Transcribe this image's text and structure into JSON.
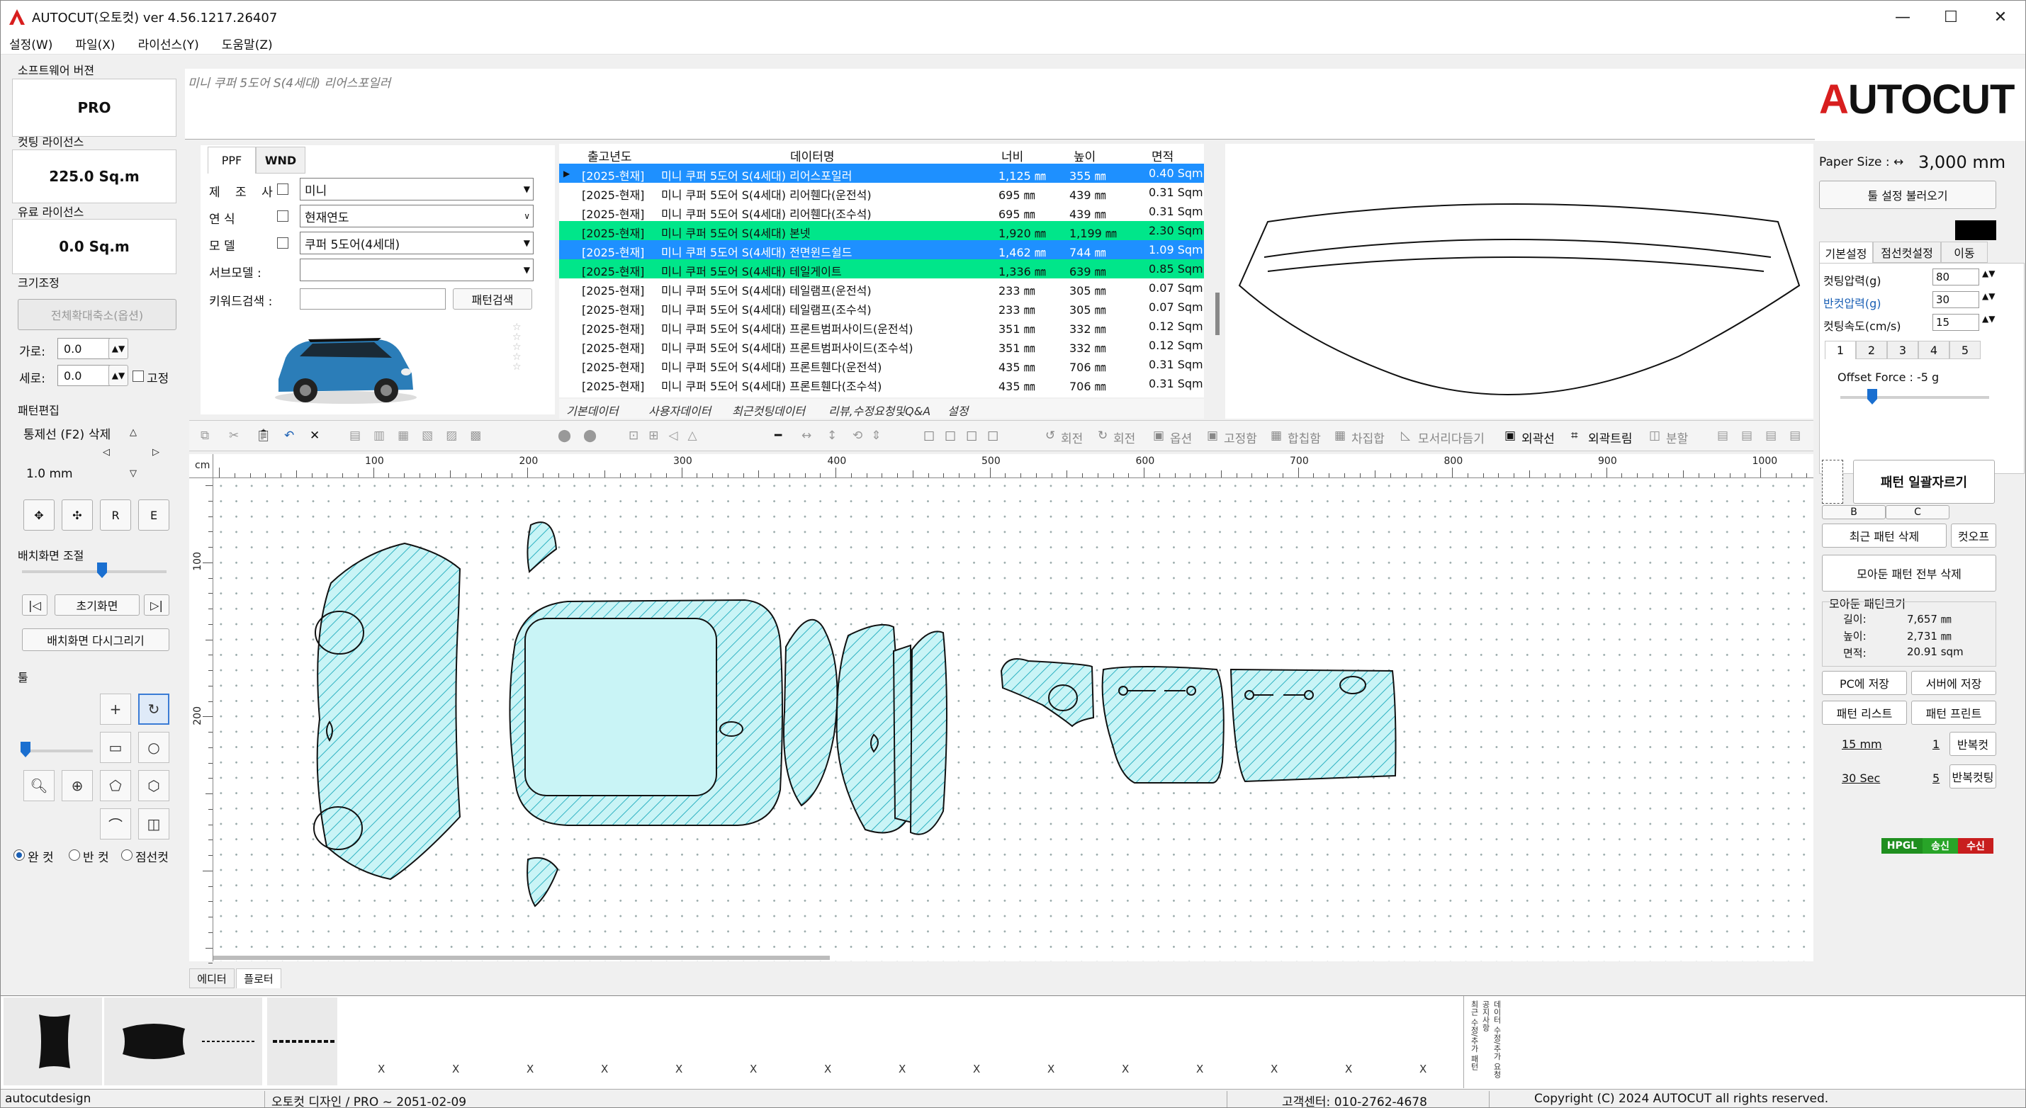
{
  "window": {
    "title": "AUTOCUT(오토컷) ver 4.56.1217.26407",
    "minimize": "—",
    "maximize": "☐",
    "close": "✕"
  },
  "menu": [
    "설정(W)",
    "파일(X)",
    "라이선스(Y)",
    "도움말(Z)"
  ],
  "left": {
    "software_version_label": "소프트웨어 버젼",
    "software_version": "PRO",
    "cutting_license_label": "컷팅 라이선스",
    "cutting_license": "225.0 Sq.m",
    "paid_license_label": "유료 라이선스",
    "paid_license": "0.0 Sq.m",
    "resize_label": "크기조정",
    "resize_all_btn": "전체확대축소(옵션)",
    "width_label": "가로:",
    "width_value": "0.0",
    "height_label": "세로:",
    "height_value": "0.0",
    "fix_label": "고정",
    "pattern_edit_label": "패턴편집",
    "move_label": "통제선 (F2)",
    "delete_label": "삭제",
    "step_value": "1.0 mm",
    "r_btn": "R",
    "e_btn": "E",
    "layout_label": "배치화면 조절",
    "reset_view_btn": "초기화면",
    "redraw_btn": "배치화면 다시그리기",
    "tools_label": "툴",
    "cut_modes": [
      "완 컷",
      "반 컷",
      "점선컷"
    ]
  },
  "header": {
    "breadcrumb": "미니 쿠퍼 5도어 S(4세대) 리어스포일러"
  },
  "filter": {
    "tabs": [
      "PPF",
      "WND"
    ],
    "maker_label": "제 조 사",
    "maker_value": "미니",
    "year_label": "연      식",
    "year_value": "현재연도",
    "model_label": "모      델",
    "model_value": "쿠퍼 5도어(4세대)",
    "submodel_label": "서브모델 :",
    "submodel_value": "",
    "keyword_label": "키워드검색 :",
    "keyword_value": "",
    "search_btn": "패턴검색"
  },
  "table": {
    "headers": [
      "출고년도",
      "데이터명",
      "너비",
      "높이",
      "면적"
    ],
    "rows": [
      {
        "year": "[2025-현재]",
        "name": "미니 쿠퍼 5도어 S(4세대) 리어스포일러",
        "w": "1,125 ㎜",
        "h": "355 ㎜",
        "area": "0.40 Sqm",
        "hl": "blue"
      },
      {
        "year": "[2025-현재]",
        "name": "미니 쿠퍼 5도어 S(4세대) 리어휀다(운전석)",
        "w": "695 ㎜",
        "h": "439 ㎜",
        "area": "0.31 Sqm",
        "hl": ""
      },
      {
        "year": "[2025-현재]",
        "name": "미니 쿠퍼 5도어 S(4세대) 리어휀다(조수석)",
        "w": "695 ㎜",
        "h": "439 ㎜",
        "area": "0.31 Sqm",
        "hl": ""
      },
      {
        "year": "[2025-현재]",
        "name": "미니 쿠퍼 5도어 S(4세대) 본넷",
        "w": "1,920 ㎜",
        "h": "1,199 ㎜",
        "area": "2.30 Sqm",
        "hl": "green"
      },
      {
        "year": "[2025-현재]",
        "name": "미니 쿠퍼 5도어 S(4세대) 전면윈드쉴드",
        "w": "1,462 ㎜",
        "h": "744 ㎜",
        "area": "1.09 Sqm",
        "hl": "blue"
      },
      {
        "year": "[2025-현재]",
        "name": "미니 쿠퍼 5도어 S(4세대) 테일게이트",
        "w": "1,336 ㎜",
        "h": "639 ㎜",
        "area": "0.85 Sqm",
        "hl": "green"
      },
      {
        "year": "[2025-현재]",
        "name": "미니 쿠퍼 5도어 S(4세대) 테일램프(운전석)",
        "w": "233 ㎜",
        "h": "305 ㎜",
        "area": "0.07 Sqm",
        "hl": ""
      },
      {
        "year": "[2025-현재]",
        "name": "미니 쿠퍼 5도어 S(4세대) 테일램프(조수석)",
        "w": "233 ㎜",
        "h": "305 ㎜",
        "area": "0.07 Sqm",
        "hl": ""
      },
      {
        "year": "[2025-현재]",
        "name": "미니 쿠퍼 5도어 S(4세대) 프론트범퍼사이드(운전석)",
        "w": "351 ㎜",
        "h": "332 ㎜",
        "area": "0.12 Sqm",
        "hl": ""
      },
      {
        "year": "[2025-현재]",
        "name": "미니 쿠퍼 5도어 S(4세대) 프론트범퍼사이드(조수석)",
        "w": "351 ㎜",
        "h": "332 ㎜",
        "area": "0.12 Sqm",
        "hl": ""
      },
      {
        "year": "[2025-현재]",
        "name": "미니 쿠퍼 5도어 S(4세대) 프론트휀다(운전석)",
        "w": "435 ㎜",
        "h": "706 ㎜",
        "area": "0.31 Sqm",
        "hl": ""
      },
      {
        "year": "[2025-현재]",
        "name": "미니 쿠퍼 5도어 S(4세대) 프론트휀다(조수석)",
        "w": "435 ㎜",
        "h": "706 ㎜",
        "area": "0.31 Sqm",
        "hl": ""
      }
    ],
    "bottom_tabs": [
      "기본데이터",
      "사용자데이터",
      "최근컷팅데이터",
      "리뷰,수정요청및Q&A",
      "설정"
    ]
  },
  "toolbar": {
    "rotate_l": "회전",
    "rotate_r": "회전",
    "option": "옵션",
    "fix": "고정함",
    "weld": "합칩함",
    "detach": "차집합",
    "corner": "모서리다듬기",
    "outline": "외곽선",
    "outline_trim": "외곽트림",
    "split": "분할"
  },
  "ruler": {
    "unit": "cm",
    "h_ticks": [
      "100",
      "200",
      "300",
      "400",
      "500",
      "600",
      "700",
      "800",
      "900",
      "1000"
    ],
    "v_ticks": [
      "100",
      "200"
    ]
  },
  "canvas_tabs": [
    "에디터",
    "플로터"
  ],
  "right": {
    "logo": "AUTOCUT",
    "paper_size_label": "Paper Size : ↔",
    "paper_size": "3,000 mm",
    "load_settings_btn": "툴 설정 불러오기",
    "tabs": [
      "기본설정",
      "점선컷설정",
      "이동"
    ],
    "cut_pressure_label": "컷팅압력(g)",
    "cut_pressure": "80",
    "half_pressure_label": "반컷압력(g)",
    "half_pressure": "30",
    "cut_speed_label": "컷팅속도(cm/s)",
    "cut_speed": "15",
    "num_tabs": [
      "1",
      "2",
      "3",
      "4",
      "5"
    ],
    "offset_force": "Offset Force : -5 g",
    "bulk_cut_btn": "패턴 일괄자르기",
    "b_label": "B",
    "c_label": "C",
    "recent_delete_btn": "최근 패턴 삭제",
    "cutoff_btn": "컷오프",
    "delete_all_btn": "모아둔 패턴 전부 삭제",
    "collected_label": "모아둔 패턴크기",
    "len_label": "길이:",
    "len_value": "7,657 ㎜",
    "hgt_label": "높이:",
    "hgt_value": "2,731 ㎜",
    "area_label": "면적:",
    "area_value": "20.91 sqm",
    "save_pc_btn": "PC에 저장",
    "save_server_btn": "서버에 저장",
    "pattern_list_btn": "패턴 리스트",
    "pattern_print_btn": "패턴 프린트",
    "repeat_mm": "15 mm",
    "repeat_count_1": "1",
    "repeat_btn_1": "반복컷",
    "repeat_sec": "30 Sec",
    "repeat_count_2": "5",
    "repeat_btn_2": "반복컷팅",
    "hpgl": "HPGL",
    "send": "송신",
    "recv": "수신",
    "colors": {
      "hpgl": "#1f8f1f",
      "send": "#28a428",
      "recv": "#c81e1e"
    }
  },
  "bottom": {
    "x_marks": [
      "X",
      "X",
      "X",
      "X",
      "X",
      "X",
      "X",
      "X",
      "X",
      "X",
      "X",
      "X",
      "X",
      "X",
      "X"
    ],
    "vertical_tabs": [
      "최근 수정/추가 패턴",
      "공지사항",
      "데이터 수정/추가 요청"
    ]
  },
  "status": {
    "user": "autocutdesign",
    "info": "오토컷 디자인 / PRO ~ 2051-02-09",
    "phone": "고객센터: 010-2762-4678",
    "copyright": "Copyright (C) 2024 AUTOCUT all rights reserved."
  }
}
